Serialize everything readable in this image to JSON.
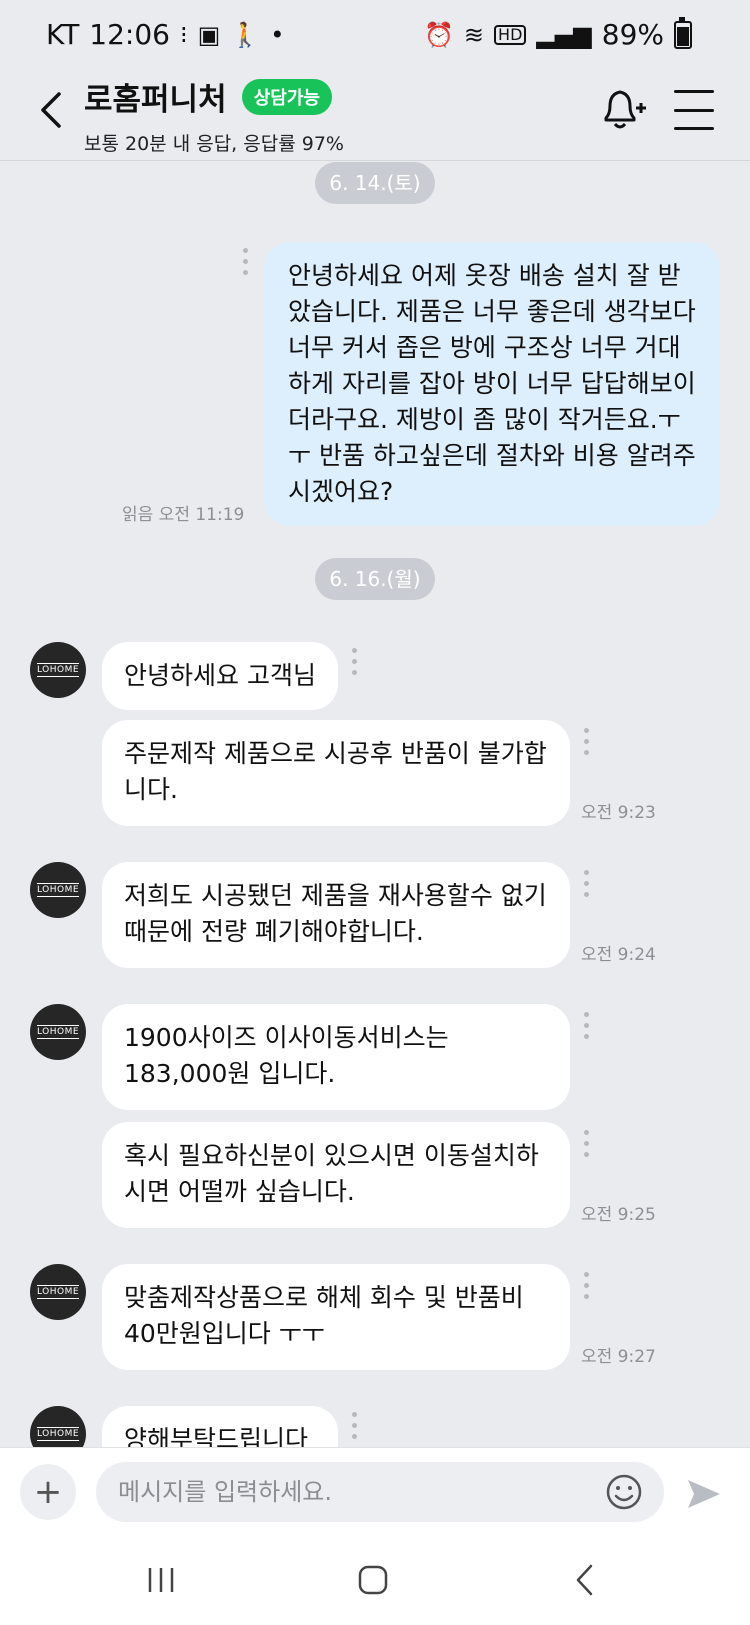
{
  "status_bar": {
    "carrier": "KT",
    "time": "12:06",
    "battery": "89%"
  },
  "header": {
    "shop_name": "로홈퍼니처",
    "badge": "상담가능",
    "reply_info": "보통 20분 내 응답, 응답률 97%"
  },
  "chat": {
    "date1": "6. 14.(토)",
    "date2": "6. 16.(월)",
    "sent_message": "안녕하세요 어제 옷장 배송 설치 잘 받았습니다. 제품은 너무 좋은데 생각보다 너무 커서 좁은 방에 구조상 너무 거대하게 자리를 잡아 방이 너무 답답해보이더라구요. 제방이 좀 많이 작거든요.ㅜㅜ 반품 하고싶은데 절차와 비용 알려주시겠어요?",
    "sent_meta": "읽음 오전 11:19",
    "avatar_text": "LOHOME",
    "messages": [
      {
        "text": "안녕하세요 고객님"
      },
      {
        "text": "주문제작 제품으로 시공후 반품이 불가합니다.",
        "time": "오전 9:23"
      },
      {
        "text": "저희도 시공됐던 제품을 재사용할수 없기 때문에 전량 폐기해야합니다.",
        "time": "오전 9:24"
      },
      {
        "text": "1900사이즈 이사이동서비스는 183,000원 입니다."
      },
      {
        "text": "혹시 필요하신분이 있으시면 이동설치하시면 어떨까 싶습니다.",
        "time": "오전 9:25"
      },
      {
        "text": "맞춤제작상품으로 해체 회수 및 반품비 40만원입니다 ㅜㅜ",
        "time": "오전 9:27"
      },
      {
        "text": "양해부탁드립니다"
      }
    ]
  },
  "input_bar": {
    "placeholder": "메시지를 입력하세요."
  }
}
